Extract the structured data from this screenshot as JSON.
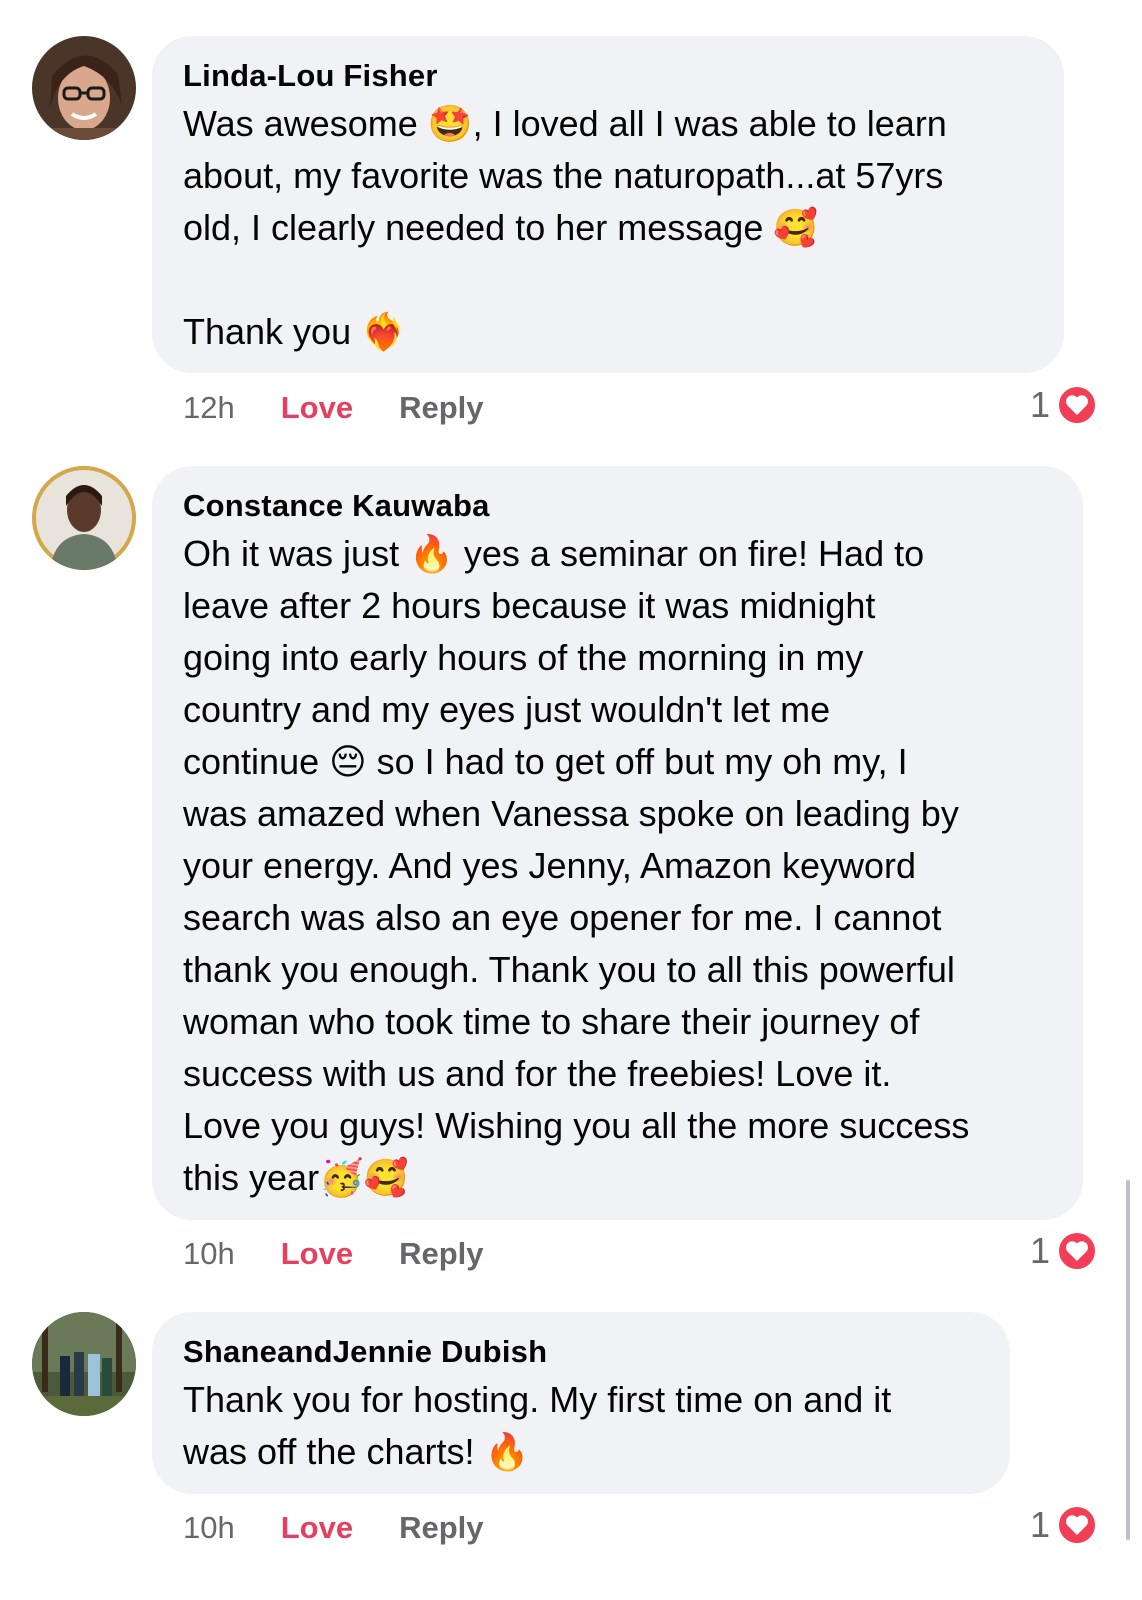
{
  "comments": [
    {
      "author": "Linda-Lou Fisher",
      "text": "Was awesome 🤩, I loved all I was able to learn\nabout, my favorite was the naturopath...at 57yrs\nold, I clearly needed to her message 🥰\n\nThank you ❤️‍🔥",
      "time": "12h",
      "love_label": "Love",
      "reply_label": "Reply",
      "reaction_count": "1",
      "avatar_icon": "profile-photo-icon"
    },
    {
      "author": "Constance Kauwaba",
      "text": "Oh it was just 🔥 yes a seminar on fire! Had to\nleave after 2 hours because it was midnight\ngoing into early hours of the morning in my\ncountry and my eyes just wouldn't let me\ncontinue 😔 so I had to get off but my oh my, I\nwas amazed when Vanessa spoke on leading by\nyour energy. And yes Jenny, Amazon keyword\nsearch was also an eye opener for me. I cannot\nthank you enough. Thank you to all this powerful\nwoman who took time to share their journey of\nsuccess with us and for the freebies! Love it.\nLove you guys! Wishing you all the more success\nthis year🥳🥰",
      "time": "10h",
      "love_label": "Love",
      "reply_label": "Reply",
      "reaction_count": "1",
      "avatar_icon": "profile-photo-icon"
    },
    {
      "author": "ShaneandJennie Dubish",
      "text": "Thank you for hosting. My first time on and it\nwas off the charts! 🔥",
      "time": "10h",
      "love_label": "Love",
      "reply_label": "Reply",
      "reaction_count": "1",
      "avatar_icon": "profile-photo-icon"
    }
  ],
  "colors": {
    "bubble": "#f0f2f5",
    "love": "#e4405f",
    "muted": "#65676b",
    "heart_badge": "#f33e58"
  }
}
